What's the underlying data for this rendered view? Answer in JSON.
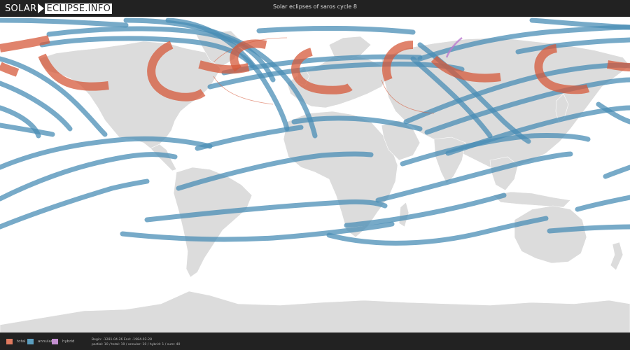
{
  "header": {
    "logo_part_a": "SOLAR",
    "logo_part_b": "ECLIPSE.INFO",
    "title": "Solar eclipses of saros cycle 8"
  },
  "legend": [
    {
      "label": "total",
      "color": "#e07a5f"
    },
    {
      "label": "annular",
      "color": "#5b9ebf"
    },
    {
      "label": "hybrid",
      "color": "#c38fd0"
    }
  ],
  "info": {
    "line1": "Begin: -1281-04-26 End: -1984-02-28",
    "line2": "partial: 10 / total: 19 / annular: 10 / hybrid: 1 / sum: 40"
  },
  "colors": {
    "land": "#dcdcdc",
    "land_border": "#ffffff",
    "ocean": "#ffffff",
    "total": "#d65a3b",
    "annular": "#4a8db5",
    "hybrid": "#b97ad0"
  }
}
